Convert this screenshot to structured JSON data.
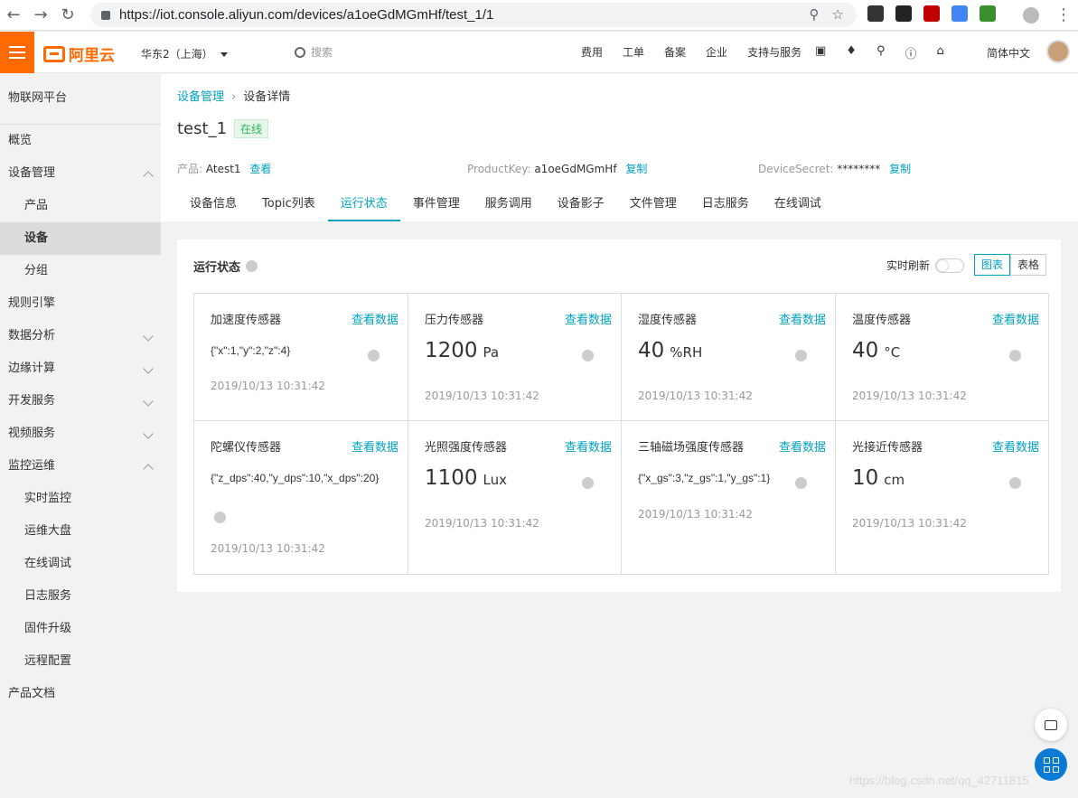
{
  "browser": {
    "url": "https://iot.console.aliyun.com/devices/a1oeGdMGmHf/test_1/1",
    "url_icons": [
      "zoom-icon",
      "star-icon"
    ],
    "extensions": [
      {
        "name": "x-extension-icon",
        "color": "#333333"
      },
      {
        "name": "ghost-extension-icon",
        "color": "#222222"
      },
      {
        "name": "abp-extension-icon",
        "color": "#c00000"
      },
      {
        "name": "translate-extension-icon",
        "color": "#4285f4"
      },
      {
        "name": "earth-extension-icon",
        "color": "#3a8f2e"
      }
    ]
  },
  "topbar": {
    "logo_text": "阿里云",
    "region": "华东2（上海）",
    "search_placeholder": "搜索",
    "nav": [
      "费用",
      "工单",
      "备案",
      "企业",
      "支持与服务"
    ],
    "lang": "简体中文"
  },
  "sidebar": {
    "title": "物联网平台",
    "items": [
      {
        "label": "概览",
        "sub": false
      },
      {
        "label": "设备管理",
        "sub": false,
        "arrow": "up"
      },
      {
        "label": "产品",
        "sub": true
      },
      {
        "label": "设备",
        "sub": true,
        "active": true
      },
      {
        "label": "分组",
        "sub": true
      },
      {
        "label": "规则引擎",
        "sub": false
      },
      {
        "label": "数据分析",
        "sub": false,
        "arrow": "down"
      },
      {
        "label": "边缘计算",
        "sub": false,
        "arrow": "down"
      },
      {
        "label": "开发服务",
        "sub": false,
        "arrow": "down"
      },
      {
        "label": "视频服务",
        "sub": false,
        "arrow": "down"
      },
      {
        "label": "监控运维",
        "sub": false,
        "arrow": "up"
      },
      {
        "label": "实时监控",
        "sub": true
      },
      {
        "label": "运维大盘",
        "sub": true
      },
      {
        "label": "在线调试",
        "sub": true
      },
      {
        "label": "日志服务",
        "sub": true
      },
      {
        "label": "固件升级",
        "sub": true
      },
      {
        "label": "远程配置",
        "sub": true
      },
      {
        "label": "产品文档",
        "sub": false
      }
    ]
  },
  "breadcrumb": {
    "link": "设备管理",
    "sep": "›",
    "current": "设备详情"
  },
  "device": {
    "name": "test_1",
    "status": "在线",
    "product_label": "产品:",
    "product": "Atest1",
    "view": "查看",
    "productkey_label": "ProductKey:",
    "productkey": "a1oeGdMGmHf",
    "copy": "复制",
    "secret_label": "DeviceSecret:",
    "secret": "********"
  },
  "tabs": [
    "设备信息",
    "Topic列表",
    "运行状态",
    "事件管理",
    "服务调用",
    "设备影子",
    "文件管理",
    "日志服务",
    "在线调试"
  ],
  "active_tab": 2,
  "panel": {
    "title": "运行状态",
    "refresh_label": "实时刷新",
    "realtime_refresh": false,
    "view_chart": "图表",
    "view_table": "表格"
  },
  "sensors": [
    {
      "name": "加速度传感器",
      "link": "查看数据",
      "json": "{\"x\":1,\"y\":2,\"z\":4}",
      "time": "2019/10/13 10:31:42"
    },
    {
      "name": "压力传感器",
      "link": "查看数据",
      "value": "1200",
      "unit": "Pa",
      "time": "2019/10/13 10:31:42"
    },
    {
      "name": "湿度传感器",
      "link": "查看数据",
      "value": "40",
      "unit": "%RH",
      "time": "2019/10/13 10:31:42"
    },
    {
      "name": "温度传感器",
      "link": "查看数据",
      "value": "40",
      "unit": "°C",
      "time": "2019/10/13 10:31:42"
    },
    {
      "name": "陀螺仪传感器",
      "link": "查看数据",
      "json": "{\"z_dps\":40,\"y_dps\":10,\"x_dps\":20}",
      "time": "2019/10/13 10:31:42"
    },
    {
      "name": "光照强度传感器",
      "link": "查看数据",
      "value": "1100",
      "unit": "Lux",
      "time": "2019/10/13 10:31:42"
    },
    {
      "name": "三轴磁场强度传感器",
      "link": "查看数据",
      "json": "{\"x_gs\":3,\"z_gs\":1,\"y_gs\":1}",
      "time": "2019/10/13 10:31:42"
    },
    {
      "name": "光接近传感器",
      "link": "查看数据",
      "value": "10",
      "unit": "cm",
      "time": "2019/10/13 10:31:42"
    }
  ],
  "watermark": "https://blog.csdn.net/qq_42711815"
}
